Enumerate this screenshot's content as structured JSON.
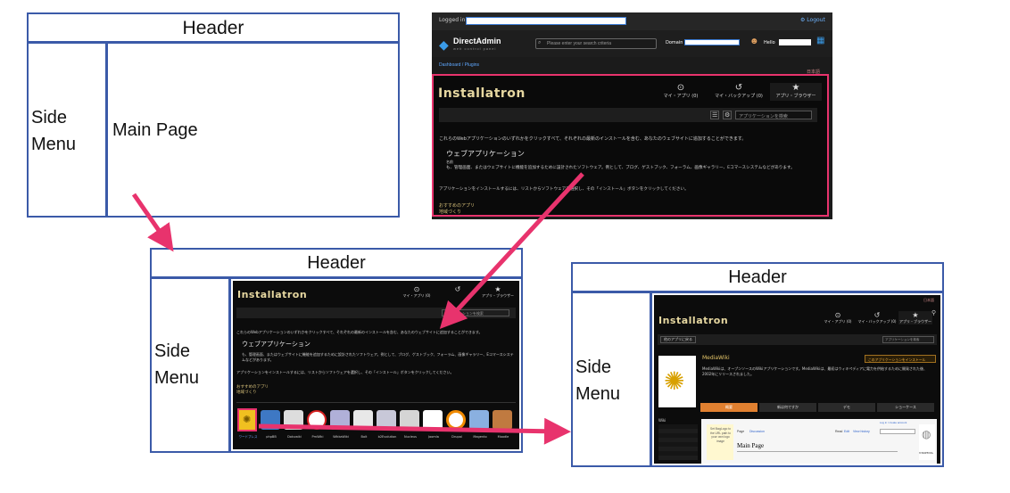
{
  "wireframe": {
    "header": "Header",
    "side_menu": "Side\nMenu",
    "main_page": "Main Page"
  },
  "directadmin": {
    "logged_in_as": "Logged in as:",
    "logout": "Logout",
    "brand": "DirectAdmin",
    "brand_sub": "web control panel",
    "search_placeholder": "Please enter your search criteria",
    "domain_label": "Domain",
    "hello_label": "Hello",
    "breadcrumb": "Dashboard / Plugins"
  },
  "installatron": {
    "logo": "Installatron",
    "tabs": [
      "マイ・アプリ (0)",
      "マイ・バックアップ (0)",
      "アプリ・ブラウザー"
    ],
    "search_placeholder": "アプリケーションを検索",
    "intro": "これらのWebアプリケーションのいずれかをクリックすべて、それぞれの最新のインストールを含む、あなたのウェブサイトに追加することができます。",
    "section_title": "ウェブアプリケーション",
    "section_sub": "名前",
    "section_body": "も、管理画面、またはウェブサイトに機能を追加するために設計されたソフトウェア。例として、ブログ、ゲストブック、フォーラム、画像ギャラリー、Eコマースシステムなどがあります。",
    "install_hint": "アプリケーションをインストールするには、リストからソフトウェアを選択し、その「インストール」ボタンをクリックしてください。",
    "recommended": "おすすめのアプリ",
    "recommended_sub": "地域づくり",
    "app_names": [
      "ワードプレス",
      "phpBB",
      "Dokuwiki",
      "PmWiki",
      "WikkaWiki",
      "Bolt",
      "b2Evolution",
      "Nucleus",
      "Joomla",
      "Drupal",
      "Magento",
      "Moodle",
      "Mambo"
    ]
  },
  "mediawiki": {
    "app_title": "MediaWiki",
    "install_button": "このアプリケーションをインストール",
    "description": "MediaWikiは、オープンソースのWikiアプリケーションです。MediaWikiは、最初はウィキペディアに電力を供給するために開発された後、2002年にリリースされました。",
    "tabs": [
      "概要",
      "新は何ですか",
      "デモ",
      "ショーケース"
    ],
    "preview_page_title": "Main Page",
    "preview_tabs": [
      "Page",
      "Discussion"
    ],
    "preview_actions": [
      "Read",
      "Edit",
      "View history"
    ],
    "preview_logo_text": "Set $wgLogo to the URL path to your own logo image",
    "preview_footer": "WIKIPEDIA",
    "preview_login": "Log in / create account",
    "side_heading": "Wiki",
    "back_button": "他のアプリに戻る"
  },
  "colors": {
    "wireframe_border": "#3b5aa8",
    "arrow": "#e8336d",
    "screen_bg": "#0c0c0c",
    "logo_gold": "#e6d7a0"
  }
}
